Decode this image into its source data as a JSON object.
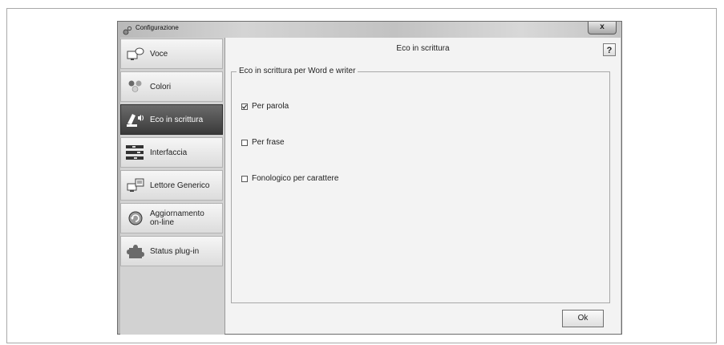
{
  "window": {
    "title": "Configurazione",
    "close_label": "x"
  },
  "sidebar": {
    "items": [
      {
        "label": "Voce",
        "icon": "monitor-speech-icon",
        "active": false
      },
      {
        "label": "Colori",
        "icon": "color-dots-icon",
        "active": false
      },
      {
        "label": "Eco in scrittura",
        "icon": "typing-echo-icon",
        "active": true
      },
      {
        "label": "Interfaccia",
        "icon": "interface-blocks-icon",
        "active": false
      },
      {
        "label": "Lettore Generico",
        "icon": "monitor-reader-icon",
        "active": false
      },
      {
        "label": "Aggiornamento\non-line",
        "icon": "update-refresh-icon",
        "active": false
      },
      {
        "label": "Status plug-in",
        "icon": "puzzle-piece-icon",
        "active": false
      }
    ]
  },
  "content": {
    "title": "Eco in scrittura",
    "help_label": "?",
    "group_label": "Eco in scrittura per Word e writer",
    "options": [
      {
        "label": "Per parola",
        "checked": true
      },
      {
        "label": "Per frase",
        "checked": false
      },
      {
        "label": "Fonologico per carattere",
        "checked": false
      }
    ],
    "ok_label": "Ok"
  }
}
